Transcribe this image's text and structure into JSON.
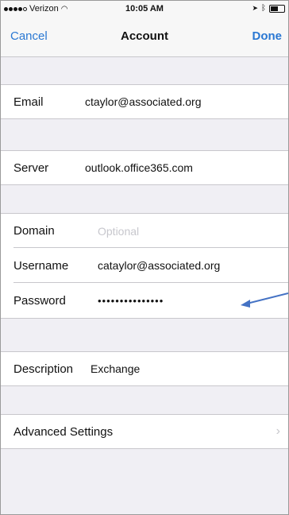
{
  "status_bar": {
    "carrier": "Verizon",
    "time": "10:05 AM"
  },
  "nav": {
    "cancel": "Cancel",
    "title": "Account",
    "done": "Done"
  },
  "fields": {
    "email": {
      "label": "Email",
      "value": "ctaylor@associated.org"
    },
    "server": {
      "label": "Server",
      "value": "outlook.office365.com"
    },
    "domain": {
      "label": "Domain",
      "placeholder": "Optional"
    },
    "username": {
      "label": "Username",
      "value": "cataylor@associated.org"
    },
    "password": {
      "label": "Password",
      "value": "•••••••••••••••"
    },
    "description": {
      "label": "Description",
      "value": "Exchange"
    }
  },
  "advanced": {
    "label": "Advanced Settings"
  },
  "colors": {
    "accent": "#2a78d3",
    "annotation_arrow": "#4472c4"
  }
}
